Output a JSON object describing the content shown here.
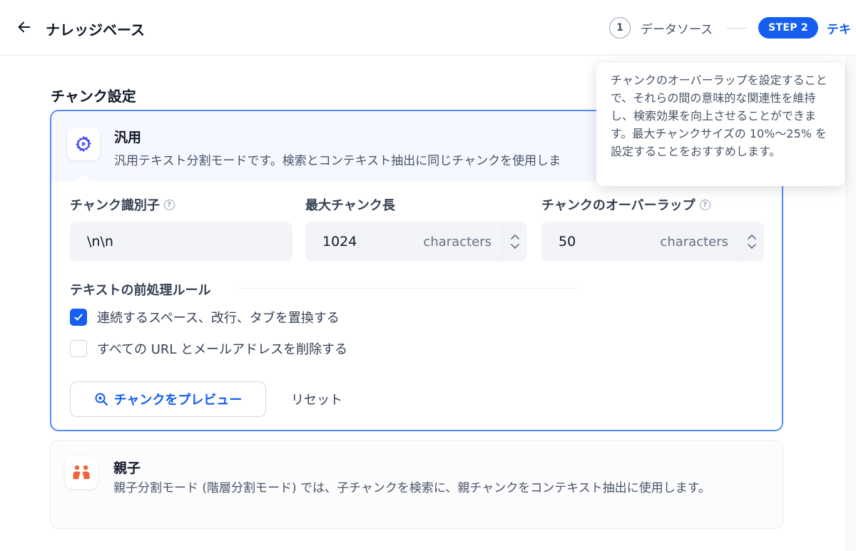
{
  "header": {
    "title": "ナレッジベース",
    "steps": [
      {
        "number": "1",
        "label": "データソース"
      },
      {
        "badge": "STEP 2",
        "label": "テキ"
      }
    ]
  },
  "section": {
    "title": "チャンク設定"
  },
  "general": {
    "name": "汎用",
    "description": "汎用テキスト分割モードです。検索とコンテキスト抽出に同じチャンクを使用しま",
    "fields": {
      "identifier": {
        "label": "チャンク識別子",
        "value": "\\n\\n"
      },
      "max_length": {
        "label": "最大チャンク長",
        "value": "1024",
        "unit": "characters"
      },
      "overlap": {
        "label": "チャンクのオーバーラップ",
        "value": "50",
        "unit": "characters"
      }
    },
    "rules": {
      "title": "テキストの前処理ルール",
      "items": [
        {
          "label": "連続するスペース、改行、タブを置換する",
          "checked": true
        },
        {
          "label": "すべての URL とメールアドレスを削除する",
          "checked": false
        }
      ]
    },
    "preview_label": "チャンクをプレビュー",
    "reset_label": "リセット"
  },
  "parent_child": {
    "name": "親子",
    "description": "親子分割モード (階層分割モード) では、子チャンクを検索に、親チャンクをコンテキスト抽出に使用します。"
  },
  "tooltip": {
    "text": "チャンクのオーバーラップを設定することで、それらの間の意味的な関連性を維持し、検索効果を向上させることができます。最大チャンクサイズの 10%〜25% を設定することをおすすめします。"
  },
  "colors": {
    "accent": "#155eef",
    "card_border": "#528bff",
    "parent_icon": "#f0643a"
  }
}
